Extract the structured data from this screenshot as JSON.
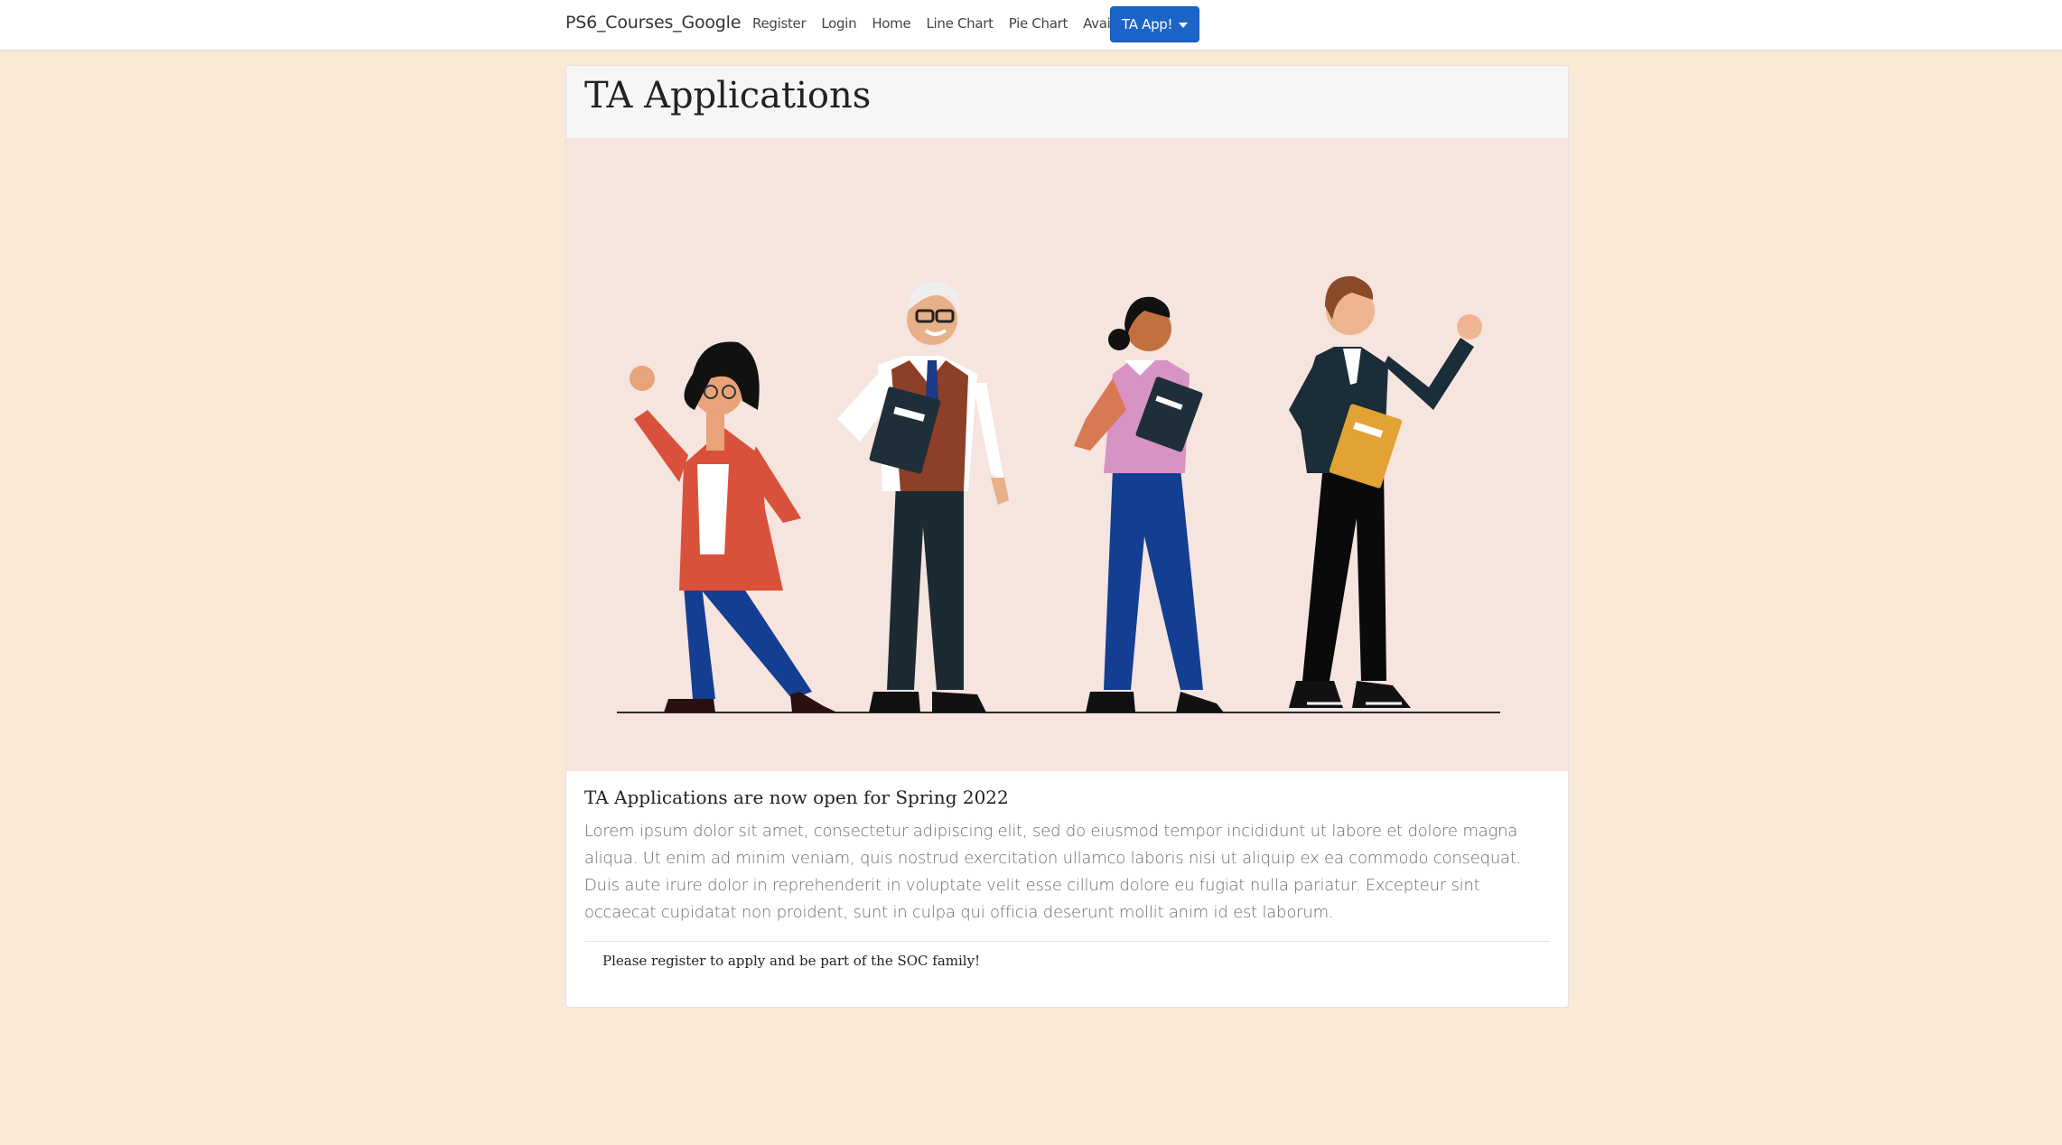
{
  "navbar": {
    "brand": "PS6_Courses_Google",
    "links": [
      "Register",
      "Login",
      "Home",
      "Line Chart",
      "Pie Chart",
      "Avail"
    ],
    "dropdown_label": "TA App!"
  },
  "card": {
    "title": "TA Applications",
    "body_title": "TA Applications are now open for Spring 2022",
    "body_text": "Lorem ipsum dolor sit amet, consectetur adipiscing elit, sed do eiusmod tempor incididunt ut labore et dolore magna aliqua. Ut enim ad minim veniam, quis nostrud exercitation ullamco laboris nisi ut aliquip ex ea commodo consequat. Duis aute irure dolor in reprehenderit in voluptate velit esse cillum dolore eu fugiat nulla pariatur. Excepteur sint occaecat cupidatat non proident, sunt in culpa qui officia deserunt mollit anim id est laborum.",
    "footer_note": "Please register to apply and be part of the SOC family!"
  },
  "colors": {
    "page_background": "#f9e9d5",
    "hero_background": "#f6e4df",
    "primary_button": "#1c64c7"
  }
}
